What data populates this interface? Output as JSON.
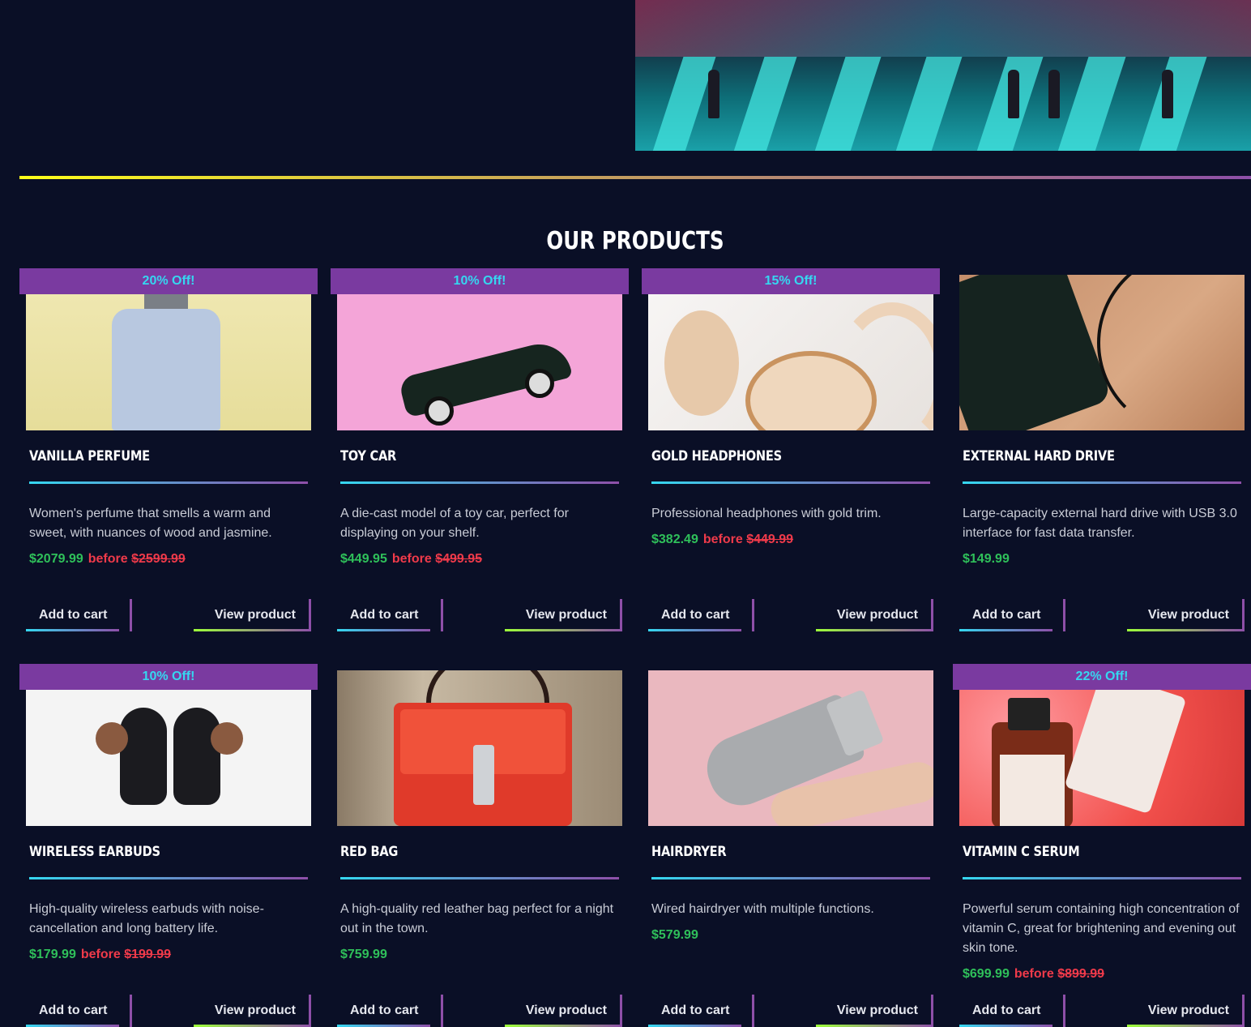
{
  "section_title": "OUR PRODUCTS",
  "colors": {
    "background": "#0a0f26",
    "badge": "#7a3aa0",
    "badge_text": "#35d7f0",
    "price_now": "#2fc05a",
    "price_before": "#ef3a4a",
    "divider_gradient": [
      "#ffff1a",
      "#8e4fa8"
    ]
  },
  "labels": {
    "add_to_cart": "Add to cart",
    "view_product": "View product",
    "before": "before"
  },
  "products": [
    {
      "badge": "20% Off!",
      "name": "Vanilla Perfume",
      "description": "Women's perfume that smells a warm and sweet, with nuances of wood and jasmine.",
      "price": "$2079.99",
      "old_price": "$2599.99",
      "image": "perfume-photo"
    },
    {
      "badge": "10% Off!",
      "name": "Toy Car",
      "description": "A die-cast model of a toy car, perfect for displaying on your shelf.",
      "price": "$449.95",
      "old_price": "$499.95",
      "image": "toy-car-photo"
    },
    {
      "badge": "15% Off!",
      "name": "Gold Headphones",
      "description": "Professional headphones with gold trim.",
      "price": "$382.49",
      "old_price": "$449.99",
      "image": "headphones-photo"
    },
    {
      "badge": "",
      "name": "External Hard Drive",
      "description": "Large-capacity external hard drive with USB 3.0 interface for fast data transfer.",
      "price": "$149.99",
      "old_price": "",
      "image": "hard-drive-photo"
    },
    {
      "badge": "10% Off!",
      "name": "Wireless Earbuds",
      "description": "High-quality wireless earbuds with noise-cancellation and long battery life.",
      "price": "$179.99",
      "old_price": "$199.99",
      "image": "earbuds-photo"
    },
    {
      "badge": "",
      "name": "Red Bag",
      "description": "A high-quality red leather bag perfect for a night out in the town.",
      "price": "$759.99",
      "old_price": "",
      "image": "red-bag-photo"
    },
    {
      "badge": "",
      "name": "Hairdryer",
      "description": "Wired hairdryer with multiple functions.",
      "price": "$579.99",
      "old_price": "",
      "image": "hairdryer-photo"
    },
    {
      "badge": "22% Off!",
      "name": "Vitamin C Serum",
      "description": "Powerful serum containing high concentration of vitamin C, great for brightening and evening out skin tone.",
      "price": "$699.99",
      "old_price": "$899.99",
      "image": "serum-photo"
    }
  ]
}
